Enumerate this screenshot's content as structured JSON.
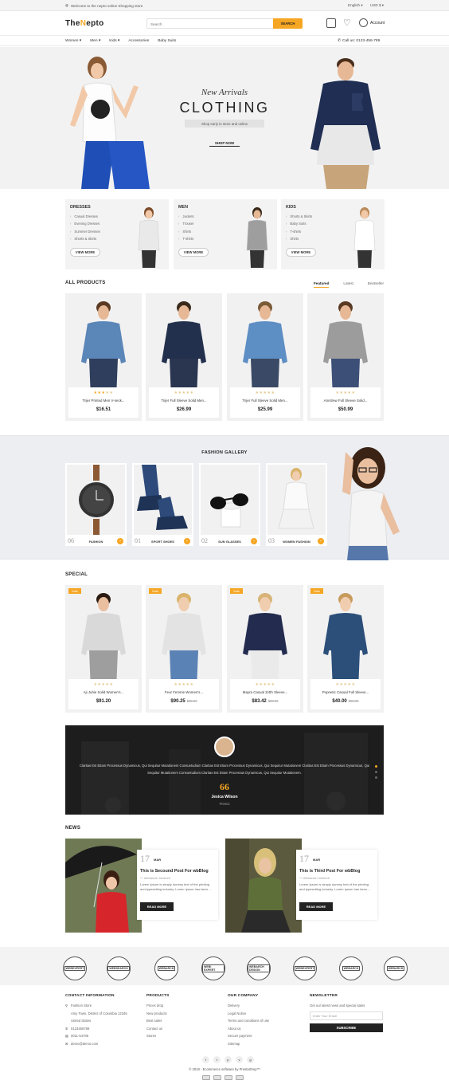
{
  "topbar": {
    "welcome": "Welcome to the nepto online Shopping store",
    "language": "English ▾",
    "currency": "USD $ ▾"
  },
  "header": {
    "logo_a": "The",
    "logo_dot": "N",
    "logo_b": "epto",
    "search_placeholder": "Search",
    "search_button": "SEARCH",
    "account": "Account"
  },
  "nav": {
    "items": [
      "Women ▾",
      "Men ▾",
      "Kids ▾",
      "Accessories",
      "Baby Suits"
    ],
    "call": "Call us: 0123-456-789"
  },
  "hero": {
    "line1": "New Arrivals",
    "line2": "CLOTHING",
    "line3": "Shop early in store and online",
    "button": "SHOP NOW"
  },
  "categories": [
    {
      "title": "DRESSES",
      "items": [
        "Casual Dresses",
        "Evening Dresses",
        "Summer Dresses",
        "Shorts & Skirts"
      ],
      "button": "VIEW MORE"
    },
    {
      "title": "MEN",
      "items": [
        "Jackets",
        "Trouser",
        "Shirts",
        "T-shirts"
      ],
      "button": "VIEW MORE"
    },
    {
      "title": "KIDS",
      "items": [
        "Shorts & Skirts",
        "Baby Suits",
        "T-shirts",
        "Shirts"
      ],
      "button": "VIEW MORE"
    }
  ],
  "all_products": {
    "title": "ALL PRODUCTS",
    "tabs": [
      "Featured",
      "Latest",
      "Bestseller"
    ],
    "items": [
      {
        "name": "Trijer Printed Men V-neck...",
        "price": "$16.51",
        "stars": 3
      },
      {
        "name": "Trijer Full Sleeve Solid Men...",
        "price": "$26.99",
        "stars": 0
      },
      {
        "name": "Trijer Full Sleeve Solid Men...",
        "price": "$25.99",
        "stars": 0
      },
      {
        "name": "Amstrew Full Sleeve Solid...",
        "price": "$50.99",
        "stars": 0
      }
    ]
  },
  "gallery": {
    "title": "FASHION GALLERY",
    "cards": [
      {
        "num": "06",
        "label": "FASHION"
      },
      {
        "num": "01",
        "label": "SPORT SHOES"
      },
      {
        "num": "02",
        "label": "SUN GLASSES"
      },
      {
        "num": "03",
        "label": "WOMEN FASHION"
      }
    ]
  },
  "special": {
    "title": "SPECIAL",
    "sale_badge": "Sale",
    "items": [
      {
        "name": "Aji Juhie Solid Women's...",
        "price": "$91.20",
        "old": ""
      },
      {
        "name": "Feur Femme Women's...",
        "price": "$90.25",
        "old": "$95.00"
      },
      {
        "name": "Mayra Casual 3/4th Sleeve...",
        "price": "$83.42",
        "old": "$88.00"
      },
      {
        "name": "Popnetic Casual Full Sleeve...",
        "price": "$40.00",
        "old": "$50.00"
      }
    ]
  },
  "testimonial": {
    "quote": "Claritas Est Etiam Processus Dynamicus, Qui Sequitur Mutationem Consuetudium Claritas Est Etiam Processus Dynamicus, Qui Sequitur Mutationem Claritas Est Etiam Processus Dynamicus, Qui Sequitur Mutationem Consuetudium.Claritas Est Etiam Processus Dynamicus, Qui Sequitur Mutationem.",
    "mark": "66",
    "name": "Jesica Wilson",
    "role": "Fresco"
  },
  "news": {
    "title": "NEWS",
    "posts": [
      {
        "day": "17",
        "month": "MAR",
        "heading": "This is Secound Post For wbBlog",
        "author": "Webarsch Infotech",
        "excerpt": "Lorem Ipsum is simply dummy text of the printing and typesetting industry. Lorem Ipsum has been ...",
        "button": "READ MORE"
      },
      {
        "day": "17",
        "month": "MAR",
        "heading": "This is Third Post For wbBlog",
        "author": "Webarsch Infotech",
        "excerpt": "Lorem Ipsum is simply dummy text of the printing and typesetting industry. Lorem Ipsum has been ...",
        "button": "READ MORE"
      }
    ]
  },
  "brands": [
    "WEBEXPERT",
    "WEBSEARCH",
    "WEBARCH",
    "WEBI EXPERT",
    "WEBARCH DESIGN",
    "WEBEXPERT",
    "WEBARCH",
    "WEBARCH"
  ],
  "footer": {
    "contact": {
      "title": "CONTACT INFORMATION",
      "lines": [
        "Fashion Store",
        "Amy Town, District of Columbia 12345",
        "United States",
        "0123456789",
        "0011-54785",
        "demo@demo.com"
      ]
    },
    "products": {
      "title": "PRODUCTS",
      "links": [
        "Prices drop",
        "New products",
        "Best sales",
        "Contact us",
        "Stores"
      ]
    },
    "company": {
      "title": "OUR COMPANY",
      "links": [
        "Delivery",
        "Legal Notice",
        "Terms and conditions of use",
        "About us",
        "Secure payment",
        "Sitemap"
      ]
    },
    "newsletter": {
      "title": "NEWSLETTER",
      "text": "Get our latest news and special sales",
      "placeholder": "Enter Your Email",
      "button": "SUBSCRIBE"
    },
    "socials": [
      "f",
      "t",
      "p",
      "v",
      "g"
    ],
    "copyright": "© 2019 - Ecommerce software by PrestaShop™"
  },
  "colors": {
    "accent": "#f5a623",
    "dark": "#222222"
  }
}
